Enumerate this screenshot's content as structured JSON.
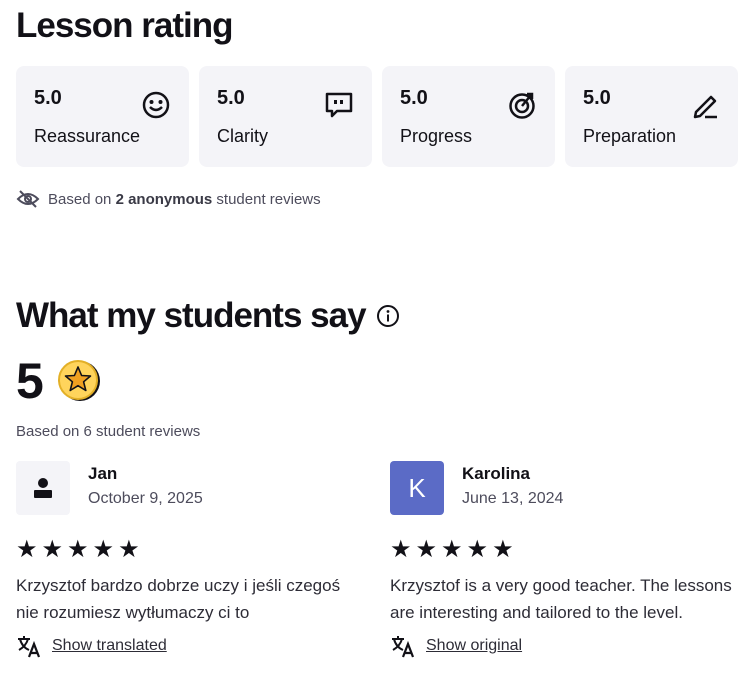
{
  "lesson_rating": {
    "title": "Lesson rating",
    "categories": [
      {
        "value": "5.0",
        "label": "Reassurance",
        "icon": "smiley-icon"
      },
      {
        "value": "5.0",
        "label": "Clarity",
        "icon": "chat-bubble-icon"
      },
      {
        "value": "5.0",
        "label": "Progress",
        "icon": "progress-target-icon"
      },
      {
        "value": "5.0",
        "label": "Preparation",
        "icon": "pencil-icon"
      }
    ],
    "basis_prefix": "Based on",
    "basis_count": "2 anonymous",
    "basis_suffix": "student reviews"
  },
  "students_say": {
    "title": "What my students say",
    "overall": "5",
    "review_count_text": "Based on 6 student reviews"
  },
  "reviews": [
    {
      "name": "Jan",
      "date": "October 9, 2025",
      "avatar": "person-icon",
      "stars": "★★★★★",
      "rating": 5,
      "text": "Krzysztof bardzo dobrze uczy i jeśli czegoś nie rozumiesz wytłumaczy ci to",
      "link": "Show translated"
    },
    {
      "name": "Karolina",
      "date": "June 13, 2024",
      "avatar_letter": "K",
      "stars": "★★★★★",
      "rating": 5,
      "text": "Krzysztof is a very good teacher. The lessons are interesting and tailored to the level.",
      "link": "Show original"
    }
  ]
}
